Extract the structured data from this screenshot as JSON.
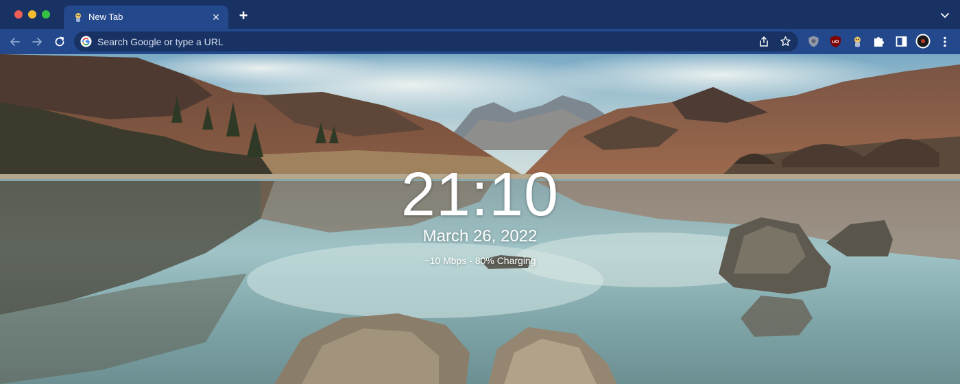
{
  "browser": {
    "tab": {
      "title": "New Tab",
      "close_glyph": "✕",
      "favicon": "extension-mascot-icon"
    },
    "new_tab_glyph": "+",
    "omnibox": {
      "placeholder": "Search Google or type a URL"
    },
    "icons": {
      "back": "arrow-left-icon",
      "forward": "arrow-right-icon",
      "reload": "reload-icon",
      "share": "share-icon",
      "bookmark": "star-icon",
      "extensions": [
        "privacy-extension-icon",
        "ublock-origin-icon",
        "mascot-extension-icon",
        "puzzle-icon"
      ],
      "side_panel": "side-panel-icon",
      "menu": "kebab-menu-icon"
    },
    "colors": {
      "tabstrip": "#183263",
      "toolbar": "#23488c",
      "omnibox": "#183263"
    }
  },
  "newtab": {
    "time": "21:10",
    "date": "March 26, 2022",
    "status": "~10 Mbps - 80% Charging"
  }
}
